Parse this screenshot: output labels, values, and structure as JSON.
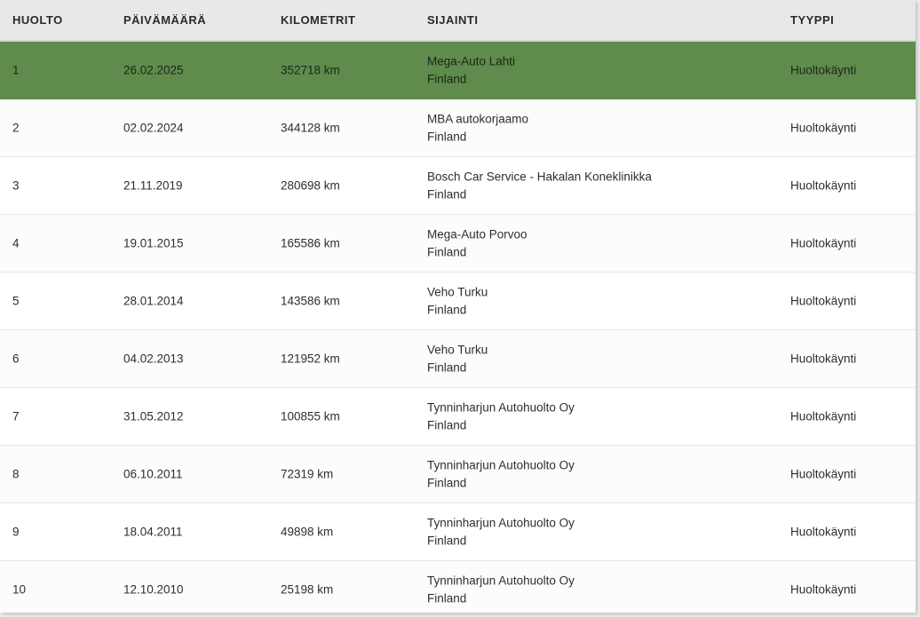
{
  "table": {
    "headers": {
      "service": "HUOLTO",
      "date": "PÄIVÄMÄÄRÄ",
      "km": "KILOMETRIT",
      "location": "SIJAINTI",
      "type": "TYYPPI"
    },
    "selected_row": 0,
    "colors": {
      "selected_row_bg": "#5f8b4c",
      "header_bg": "#e6e8ea"
    },
    "rows": [
      {
        "service": "1",
        "date": "26.02.2025",
        "km": "352718 km",
        "location": "Mega-Auto Lahti",
        "country": "Finland",
        "type": "Huoltokäynti"
      },
      {
        "service": "2",
        "date": "02.02.2024",
        "km": "344128 km",
        "location": "MBA autokorjaamo",
        "country": "Finland",
        "type": "Huoltokäynti"
      },
      {
        "service": "3",
        "date": "21.11.2019",
        "km": "280698 km",
        "location": "Bosch Car Service - Hakalan Koneklinikka",
        "country": "Finland",
        "type": "Huoltokäynti"
      },
      {
        "service": "4",
        "date": "19.01.2015",
        "km": "165586 km",
        "location": "Mega-Auto Porvoo",
        "country": "Finland",
        "type": "Huoltokäynti"
      },
      {
        "service": "5",
        "date": "28.01.2014",
        "km": "143586 km",
        "location": "Veho Turku",
        "country": "Finland",
        "type": "Huoltokäynti"
      },
      {
        "service": "6",
        "date": "04.02.2013",
        "km": "121952 km",
        "location": "Veho Turku",
        "country": "Finland",
        "type": "Huoltokäynti"
      },
      {
        "service": "7",
        "date": "31.05.2012",
        "km": "100855 km",
        "location": "Tynninharjun Autohuolto Oy",
        "country": "Finland",
        "type": "Huoltokäynti"
      },
      {
        "service": "8",
        "date": "06.10.2011",
        "km": "72319 km",
        "location": "Tynninharjun Autohuolto Oy",
        "country": "Finland",
        "type": "Huoltokäynti"
      },
      {
        "service": "9",
        "date": "18.04.2011",
        "km": "49898 km",
        "location": "Tynninharjun Autohuolto Oy",
        "country": "Finland",
        "type": "Huoltokäynti"
      },
      {
        "service": "10",
        "date": "12.10.2010",
        "km": "25198 km",
        "location": "Tynninharjun Autohuolto Oy",
        "country": "Finland",
        "type": "Huoltokäynti"
      }
    ]
  }
}
